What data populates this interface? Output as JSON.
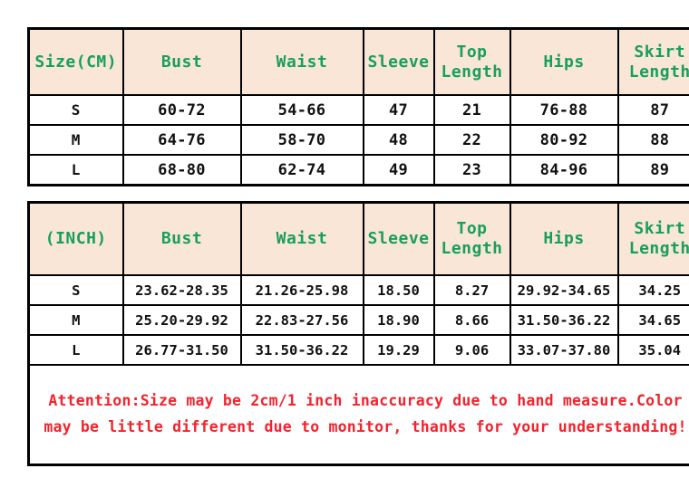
{
  "colors": {
    "header_text": "#17a05a",
    "header_fill": "#fae6d7",
    "data_text": "#111111",
    "data_fill": "#ffffff",
    "notice_text": "#f4222c",
    "border": "#000000",
    "page_background": "#ffffff"
  },
  "cm_table": {
    "headers": [
      "Size(CM)",
      "Bust",
      "Waist",
      "Sleeve",
      "Top\nLength",
      "Hips",
      "Skirt\nLength"
    ],
    "rows": [
      {
        "size": "S",
        "bust": "60-72",
        "waist": "54-66",
        "sleeve": "47",
        "top_length": "21",
        "hips": "76-88",
        "skirt_length": "87"
      },
      {
        "size": "M",
        "bust": "64-76",
        "waist": "58-70",
        "sleeve": "48",
        "top_length": "22",
        "hips": "80-92",
        "skirt_length": "88"
      },
      {
        "size": "L",
        "bust": "68-80",
        "waist": "62-74",
        "sleeve": "49",
        "top_length": "23",
        "hips": "84-96",
        "skirt_length": "89"
      }
    ]
  },
  "inch_table": {
    "headers": [
      "(INCH)",
      "Bust",
      "Waist",
      "Sleeve",
      "Top\nLength",
      "Hips",
      "Skirt\nLength"
    ],
    "rows": [
      {
        "size": "S",
        "bust": "23.62-28.35",
        "waist": "21.26-25.98",
        "sleeve": "18.50",
        "top_length": "8.27",
        "hips": "29.92-34.65",
        "skirt_length": "34.25"
      },
      {
        "size": "M",
        "bust": "25.20-29.92",
        "waist": "22.83-27.56",
        "sleeve": "18.90",
        "top_length": "8.66",
        "hips": "31.50-36.22",
        "skirt_length": "34.65"
      },
      {
        "size": "L",
        "bust": "26.77-31.50",
        "waist": "31.50-36.22",
        "sleeve": "19.29",
        "top_length": "9.06",
        "hips": "33.07-37.80",
        "skirt_length": "35.04"
      }
    ]
  },
  "notice": {
    "text": "Attention:Size may be 2cm/1 inch inaccuracy due to hand measure.Color\nmay be little different due to monitor, thanks for your understanding!"
  }
}
